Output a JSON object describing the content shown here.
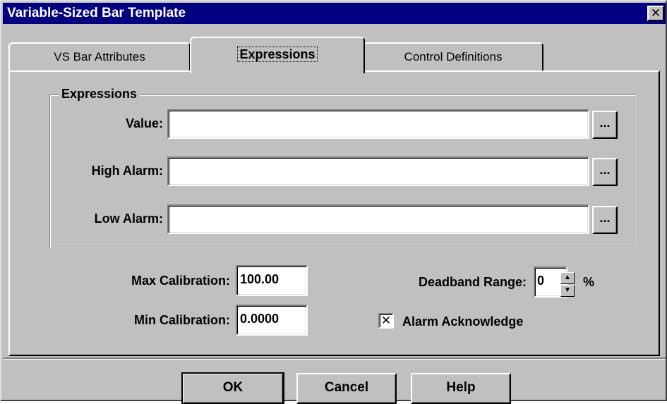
{
  "window": {
    "title": "Variable-Sized Bar Template",
    "close_glyph": "✕"
  },
  "tabs": [
    {
      "label": "VS Bar Attributes",
      "active": false
    },
    {
      "label": "Expressions",
      "active": true
    },
    {
      "label": "Control Definitions",
      "active": false
    }
  ],
  "expressions_group": {
    "title": "Expressions",
    "fields": [
      {
        "label": "Value:",
        "value": "",
        "browse_label": "..."
      },
      {
        "label": "High Alarm:",
        "value": "",
        "browse_label": "..."
      },
      {
        "label": "Low Alarm:",
        "value": "",
        "browse_label": "..."
      }
    ]
  },
  "calibration": {
    "max_label": "Max Calibration:",
    "max_value": "100.00",
    "min_label": "Min Calibration:",
    "min_value": "0.0000"
  },
  "deadband": {
    "label": "Deadband Range:",
    "value": "0",
    "unit": "%",
    "up_icon": "▲",
    "down_icon": "▼"
  },
  "alarm_ack": {
    "label": "Alarm Acknowledge",
    "checked": true,
    "check_glyph": "✕"
  },
  "buttons": {
    "ok": "OK",
    "cancel": "Cancel",
    "help": "Help"
  }
}
